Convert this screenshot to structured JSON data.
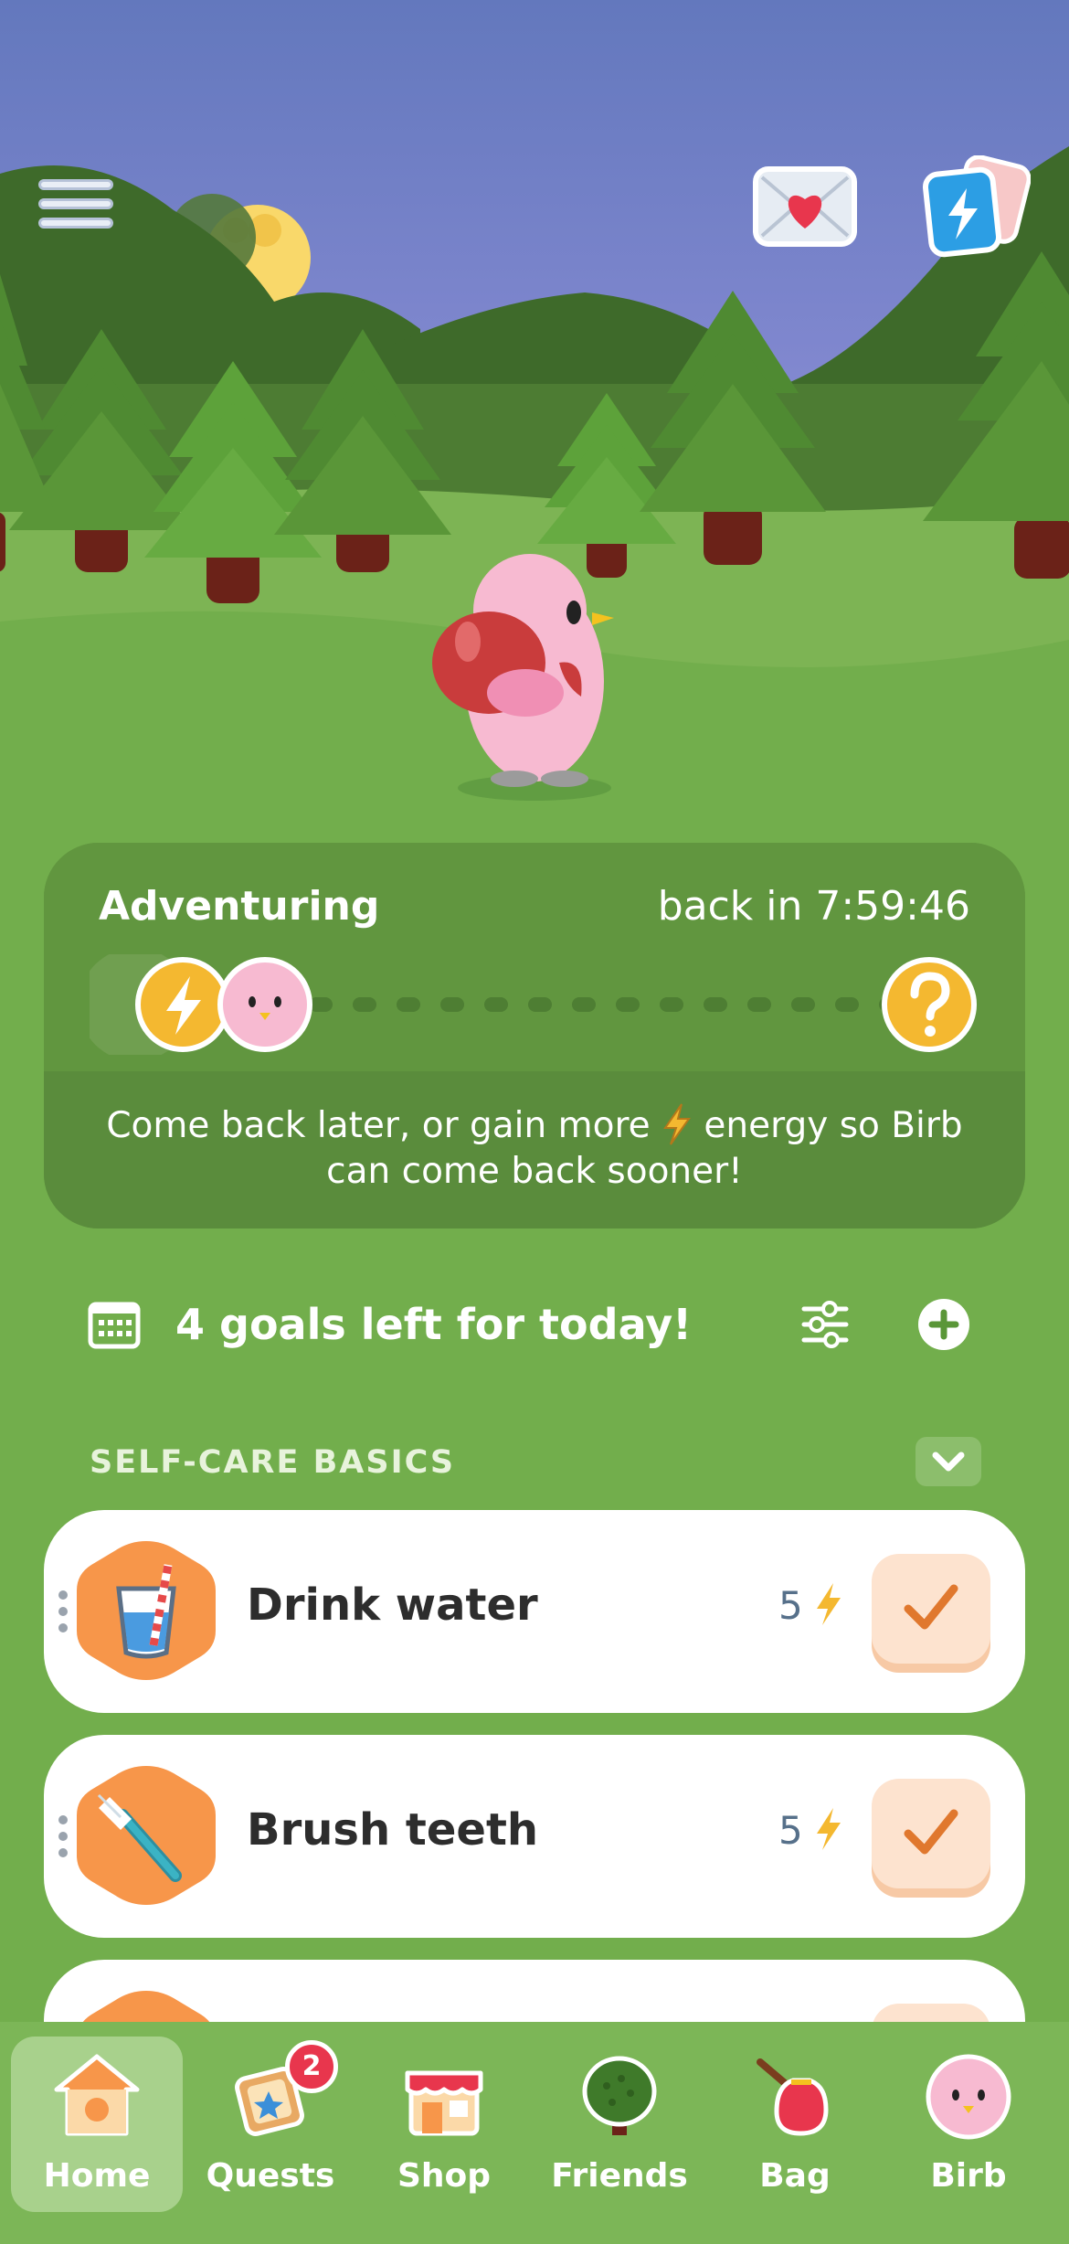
{
  "header": {
    "menu_icon": "hamburger-menu-icon",
    "mail_icon": "heart-mail-icon",
    "energy_icon": "energy-cards-icon"
  },
  "adventure": {
    "title": "Adventuring",
    "timer": "back in 7:59:46",
    "message_part1": "Come back later, or gain more ",
    "message_part2": " energy so Birb can come back sooner!",
    "mystery_icon": "question-mark-icon"
  },
  "goals": {
    "summary": "4 goals left for today!"
  },
  "section": {
    "label": "SELF-CARE BASICS"
  },
  "habits": [
    {
      "name": "Drink water",
      "points": "5",
      "icon": "water-glass-icon"
    },
    {
      "name": "Brush teeth",
      "points": "5",
      "icon": "toothbrush-icon"
    }
  ],
  "tabs": [
    {
      "label": "Home",
      "icon": "birdhouse-icon",
      "active": true
    },
    {
      "label": "Quests",
      "icon": "quest-board-icon",
      "badge": "2"
    },
    {
      "label": "Shop",
      "icon": "shop-icon"
    },
    {
      "label": "Friends",
      "icon": "tree-icon"
    },
    {
      "label": "Bag",
      "icon": "bag-icon"
    },
    {
      "label": "Birb",
      "icon": "birb-face-icon"
    }
  ],
  "colors": {
    "sky": "#6c7fc4",
    "grass": "#72ae4c",
    "accent_orange": "#f7964a",
    "energy_yellow": "#f4b830"
  }
}
